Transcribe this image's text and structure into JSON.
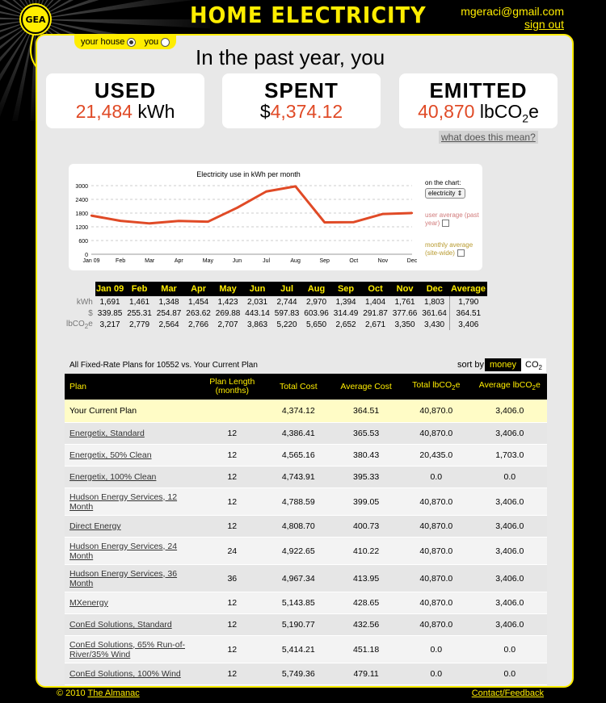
{
  "header": {
    "logo_text": "GEA",
    "title": "HOME ELECTRICITY",
    "user_email": "mgeraci@gmail.com",
    "sign_out": "sign out"
  },
  "scope_toggle": {
    "your_house": "your house",
    "you": "you",
    "selected": "your house"
  },
  "summary": {
    "headline": "In the past year, you",
    "used": {
      "label": "USED",
      "value": "21,484",
      "unit": "kWh"
    },
    "spent": {
      "label": "SPENT",
      "currency": "$",
      "value": "4,374.12"
    },
    "emitted": {
      "label": "EMITTED",
      "value": "40,870",
      "unit": "lbCO",
      "sub": "2",
      "unit_tail": "e"
    },
    "what_link": "what does this mean?"
  },
  "chart_panel": {
    "on_the_chart_label": "on the chart:",
    "selected_metric": "electricity",
    "user_average": "user average (past year)",
    "monthly_average": "monthly average (site-wide)",
    "line_color": "#e04a26",
    "user_average_color": "#d17b7b",
    "monthly_average_color": "#b89a2e"
  },
  "chart_data": {
    "type": "line",
    "title": "Electricity use in kWh per month",
    "categories": [
      "Jan 09",
      "Feb",
      "Mar",
      "Apr",
      "May",
      "Jun",
      "Jul",
      "Aug",
      "Sep",
      "Oct",
      "Nov",
      "Dec"
    ],
    "series": [
      {
        "values": [
          1691,
          1461,
          1348,
          1454,
          1423,
          2031,
          2744,
          2970,
          1394,
          1404,
          1761,
          1803
        ]
      }
    ],
    "yticks": [
      0,
      600,
      1200,
      1800,
      2400,
      3000
    ],
    "ylim": [
      0,
      3000
    ],
    "grid": true
  },
  "monthly_table": {
    "headers": [
      "Jan 09",
      "Feb",
      "Mar",
      "Apr",
      "May",
      "Jun",
      "Jul",
      "Aug",
      "Sep",
      "Oct",
      "Nov",
      "Dec",
      "Average"
    ],
    "rows": [
      {
        "label": "kWh",
        "values": [
          "1,691",
          "1,461",
          "1,348",
          "1,454",
          "1,423",
          "2,031",
          "2,744",
          "2,970",
          "1,394",
          "1,404",
          "1,761",
          "1,803",
          "1,790"
        ]
      },
      {
        "label": "$",
        "values": [
          "339.85",
          "255.31",
          "254.87",
          "263.62",
          "269.88",
          "443.14",
          "597.83",
          "603.96",
          "314.49",
          "291.87",
          "377.66",
          "361.64",
          "364.51"
        ]
      },
      {
        "label": "lbCO",
        "label_sub": "2",
        "label_tail": "e",
        "values": [
          "3,217",
          "2,779",
          "2,564",
          "2,766",
          "2,707",
          "3,863",
          "5,220",
          "5,650",
          "2,652",
          "2,671",
          "3,350",
          "3,430",
          "3,406"
        ]
      }
    ]
  },
  "plans": {
    "title": "All Fixed-Rate Plans for 10552 vs. Your Current Plan",
    "sort_by_label": "sort by:",
    "sort_money": "money",
    "sort_co2": "CO",
    "sort_co2_sub": "2",
    "columns": {
      "plan": "Plan",
      "length": "Plan Length (months)",
      "total_cost": "Total Cost",
      "avg_cost": "Average Cost",
      "total_co2": "Total lbCO",
      "total_co2_sub": "2",
      "total_co2_tail": "e",
      "avg_co2": "Average lbCO",
      "avg_co2_sub": "2",
      "avg_co2_tail": "e"
    },
    "current": {
      "name": "Your Current Plan",
      "length": "",
      "total_cost": "4,374.12",
      "avg_cost": "364.51",
      "total_co2": "40,870.0",
      "avg_co2": "3,406.0"
    },
    "rows": [
      {
        "name": "Energetix, Standard",
        "length": "12",
        "total_cost": "4,386.41",
        "avg_cost": "365.53",
        "total_co2": "40,870.0",
        "avg_co2": "3,406.0"
      },
      {
        "name": "Energetix, 50% Clean",
        "length": "12",
        "total_cost": "4,565.16",
        "avg_cost": "380.43",
        "total_co2": "20,435.0",
        "avg_co2": "1,703.0"
      },
      {
        "name": "Energetix, 100% Clean",
        "length": "12",
        "total_cost": "4,743.91",
        "avg_cost": "395.33",
        "total_co2": "0.0",
        "avg_co2": "0.0"
      },
      {
        "name": "Hudson Energy Services, 12 Month",
        "length": "12",
        "total_cost": "4,788.59",
        "avg_cost": "399.05",
        "total_co2": "40,870.0",
        "avg_co2": "3,406.0"
      },
      {
        "name": "Direct Energy",
        "length": "12",
        "total_cost": "4,808.70",
        "avg_cost": "400.73",
        "total_co2": "40,870.0",
        "avg_co2": "3,406.0"
      },
      {
        "name": "Hudson Energy Services, 24 Month",
        "length": "24",
        "total_cost": "4,922.65",
        "avg_cost": "410.22",
        "total_co2": "40,870.0",
        "avg_co2": "3,406.0"
      },
      {
        "name": "Hudson Energy Services, 36 Month",
        "length": "36",
        "total_cost": "4,967.34",
        "avg_cost": "413.95",
        "total_co2": "40,870.0",
        "avg_co2": "3,406.0"
      },
      {
        "name": "MXenergy",
        "length": "12",
        "total_cost": "5,143.85",
        "avg_cost": "428.65",
        "total_co2": "40,870.0",
        "avg_co2": "3,406.0"
      },
      {
        "name": "ConEd Solutions, Standard",
        "length": "12",
        "total_cost": "5,190.77",
        "avg_cost": "432.56",
        "total_co2": "40,870.0",
        "avg_co2": "3,406.0"
      },
      {
        "name": "ConEd Solutions, 65% Run-of-River/35% Wind",
        "length": "12",
        "total_cost": "5,414.21",
        "avg_cost": "451.18",
        "total_co2": "0.0",
        "avg_co2": "0.0"
      },
      {
        "name": "ConEd Solutions, 100% Wind",
        "length": "12",
        "total_cost": "5,749.36",
        "avg_cost": "479.11",
        "total_co2": "0.0",
        "avg_co2": "0.0"
      }
    ]
  },
  "footer": {
    "copyright": "© 2010",
    "almanac": "The Almanac",
    "contact": "Contact/Feedback"
  },
  "colors": {
    "accent": "#ffed00",
    "highlight_red": "#e04a26"
  }
}
